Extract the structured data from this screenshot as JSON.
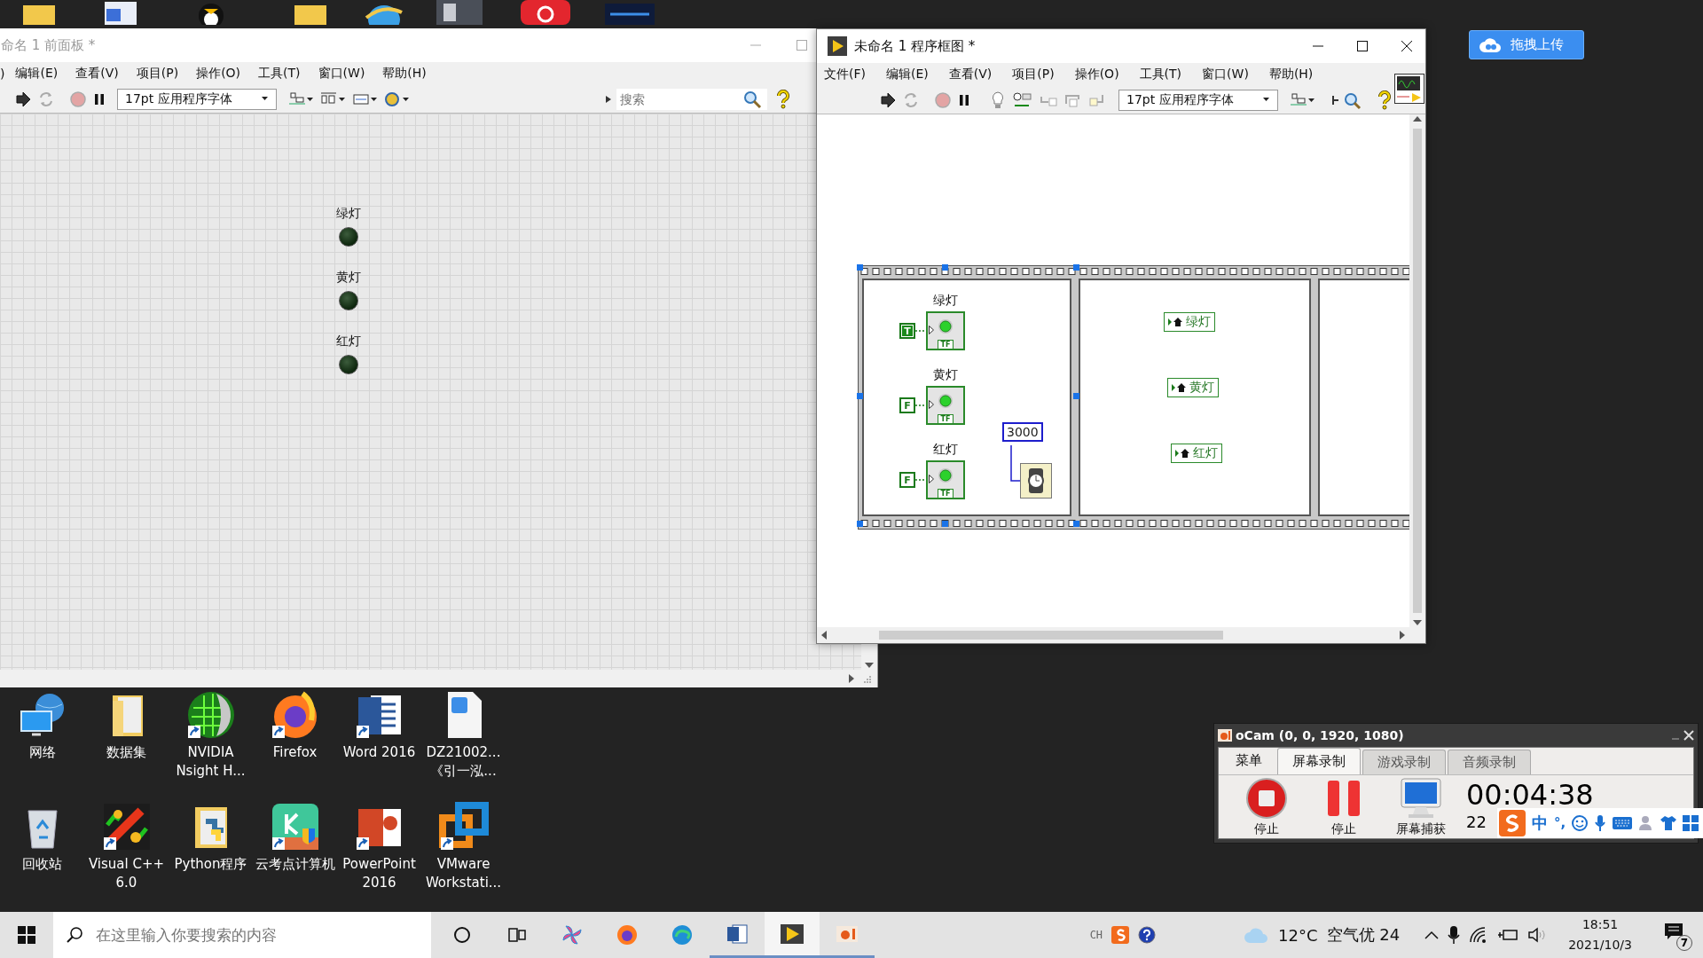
{
  "front_panel": {
    "title": "命名 1 前面板 *",
    "menu": [
      ")",
      "编辑(E)",
      "查看(V)",
      "项目(P)",
      "操作(O)",
      "工具(T)",
      "窗口(W)",
      "帮助(H)"
    ],
    "font": "17pt 应用程序字体",
    "search": {
      "placeholder": "搜索"
    },
    "indicators": [
      {
        "label": "绿灯",
        "on": false
      },
      {
        "label": "黄灯",
        "on": false
      },
      {
        "label": "红灯",
        "on": false
      }
    ]
  },
  "block_diagram": {
    "title": "未命名 1 程序框图 *",
    "menu": [
      "文件(F)",
      "编辑(E)",
      "查看(V)",
      "项目(P)",
      "操作(O)",
      "工具(T)",
      "窗口(W)",
      "帮助(H)"
    ],
    "font": "17pt 应用程序字体",
    "frames": [
      {
        "kind": "terminals",
        "terminals": [
          {
            "label": "绿灯",
            "constant": "T",
            "value": true,
            "type_label": "TF"
          },
          {
            "label": "黄灯",
            "constant": "F",
            "value": false,
            "type_label": "TF"
          },
          {
            "label": "红灯",
            "constant": "F",
            "value": false,
            "type_label": "TF"
          }
        ],
        "wait_constant": "3000"
      },
      {
        "kind": "locals",
        "locals": [
          "绿灯",
          "黄灯",
          "红灯"
        ]
      },
      {
        "kind": "empty"
      }
    ]
  },
  "upload_button": {
    "label": "拖拽上传"
  },
  "desktop_icons": [
    {
      "label": "网络",
      "kind": "network",
      "shortcut": false
    },
    {
      "label": "数据集",
      "kind": "folder",
      "shortcut": false
    },
    {
      "label": "NVIDIA Nsight H...",
      "kind": "nvidia",
      "shortcut": true
    },
    {
      "label": "Firefox",
      "kind": "firefox",
      "shortcut": true
    },
    {
      "label": "Word 2016",
      "kind": "word",
      "shortcut": true
    },
    {
      "label": "DZ21002... 《引一泓...",
      "kind": "document",
      "shortcut": false
    },
    {
      "label": "回收站",
      "kind": "recycle",
      "shortcut": false
    },
    {
      "label": "Visual C++ 6.0",
      "kind": "vcpp",
      "shortcut": true
    },
    {
      "label": "Python程序",
      "kind": "python-folder",
      "shortcut": false
    },
    {
      "label": "云考点计算机",
      "kind": "exam",
      "shortcut": true
    },
    {
      "label": "PowerPoint 2016",
      "kind": "powerpoint",
      "shortcut": true
    },
    {
      "label": "VMware Workstati...",
      "kind": "vmware",
      "shortcut": true
    }
  ],
  "ocam": {
    "title": "oCam (0, 0, 1920, 1080)",
    "menu_label": "菜单",
    "tabs": [
      {
        "label": "屏幕录制",
        "selected": true
      },
      {
        "label": "游戏录制",
        "selected": false
      },
      {
        "label": "音频录制",
        "selected": false
      }
    ],
    "actions": [
      {
        "kind": "record",
        "label": "停止"
      },
      {
        "kind": "pause",
        "label": "停止"
      },
      {
        "kind": "capture",
        "label": "屏幕捕获"
      }
    ],
    "timer": "00:04:38",
    "size_text": "22"
  },
  "ime_bar": {
    "mode": "中",
    "punctuation": "°,"
  },
  "taskbar": {
    "search": {
      "placeholder": "在这里输入你要搜索的内容"
    },
    "apps": [
      {
        "kind": "cortana",
        "active": false,
        "focused": false
      },
      {
        "kind": "task-view",
        "active": false,
        "focused": false
      },
      {
        "kind": "pinwheel",
        "active": false,
        "focused": false
      },
      {
        "kind": "firefox",
        "active": false,
        "focused": false
      },
      {
        "kind": "edge",
        "active": false,
        "focused": false
      },
      {
        "kind": "word",
        "active": true,
        "focused": false
      },
      {
        "kind": "labview",
        "active": true,
        "focused": true
      },
      {
        "kind": "ocam",
        "active": true,
        "focused": false
      }
    ],
    "input_language": "CH",
    "temperature": "12°C",
    "air_quality": "空气优 24",
    "time": "18:51",
    "date": "2021/10/3",
    "notification_count": "7"
  }
}
